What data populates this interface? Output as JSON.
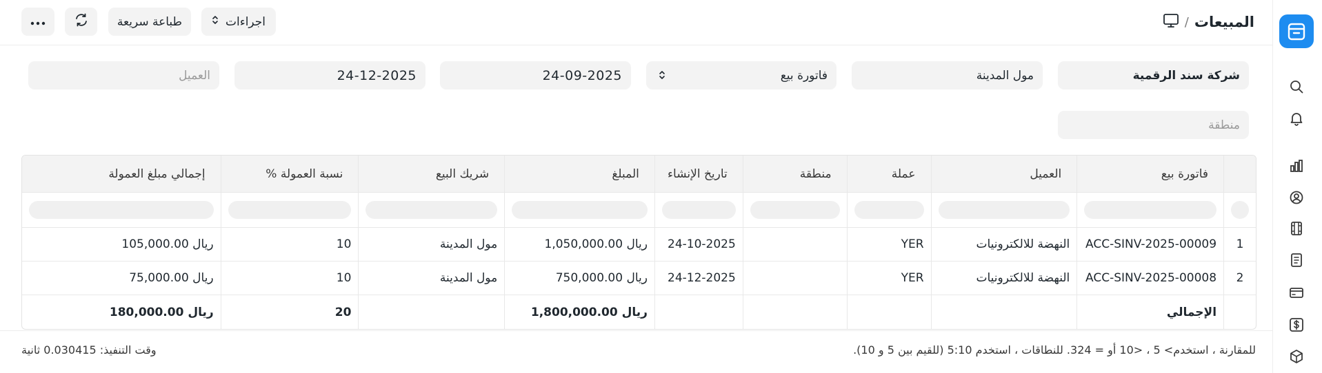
{
  "header": {
    "title": "المبيعات",
    "separator": "/",
    "actions_label": "اجراءات",
    "quick_print_label": "طباعة سريعة"
  },
  "filters": {
    "company": "شركة سند الرقمية",
    "sales_partner": "مول المدينة",
    "doc_type": "فاتورة بيع",
    "from_date": "24-09-2025",
    "to_date": "24-12-2025",
    "customer_placeholder": "العميل",
    "territory_placeholder": "منطقة"
  },
  "table": {
    "columns": [
      "فاتورة بيع",
      "العميل",
      "عملة",
      "منطقة",
      "تاريخ الإنشاء",
      "المبلغ",
      "شريك البيع",
      "نسبة العمولة %",
      "إجمالي مبلغ العمولة"
    ],
    "rows": [
      {
        "idx": "1",
        "invoice": "ACC-SINV-2025-00009",
        "customer": "النهضة للالكترونيات",
        "currency": "YER",
        "territory": "",
        "date": "24-10-2025",
        "amount": "ريال 1,050,000.00",
        "partner": "مول المدينة",
        "rate": "10",
        "commission": "ريال 105,000.00"
      },
      {
        "idx": "2",
        "invoice": "ACC-SINV-2025-00008",
        "customer": "النهضة للالكترونيات",
        "currency": "YER",
        "territory": "",
        "date": "24-12-2025",
        "amount": "ريال 750,000.00",
        "partner": "مول المدينة",
        "rate": "10",
        "commission": "ريال 75,000.00"
      }
    ],
    "total": {
      "label": "الإجمالي",
      "amount": "ريال 1,800,000.00",
      "rate": "20",
      "commission": "ريال 180,000.00"
    }
  },
  "footer": {
    "hint": "للمقارنة ، استخدم> 5 ، <10 أو = 324. للنطاقات ، استخدم 5:10 (للقيم بين 5 و 10).",
    "execution_time": "وقت التنفيذ: 0.030415 ثانية"
  }
}
